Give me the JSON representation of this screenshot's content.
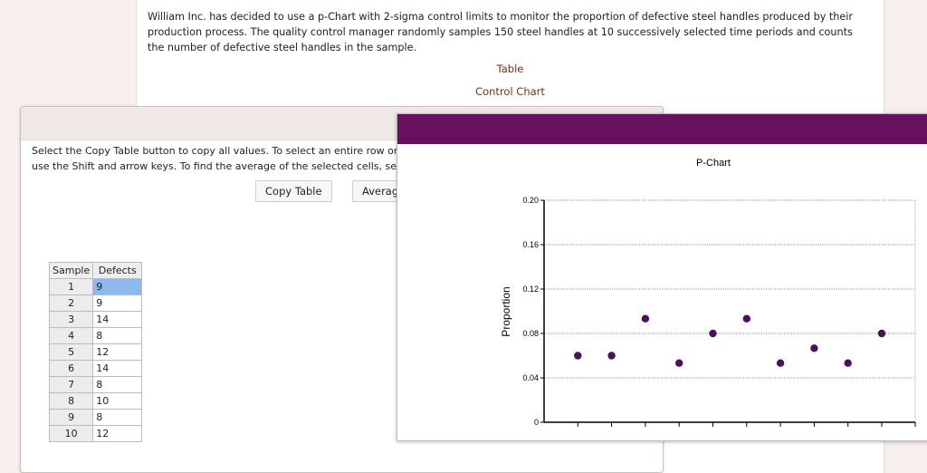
{
  "intro": "William Inc. has decided to use a p-Chart with 2-sigma control limits to monitor the proportion of defective steel handles produced by their production process. The quality control manager randomly samples 150 steel handles at 10 successively selected time periods and counts the number of defective steel handles in the sample.",
  "links": {
    "table": "Table",
    "control_chart": "Control Chart"
  },
  "dialog": {
    "instructions_line1": "Select the Copy Table button to copy all values. To select an entire row or co",
    "instructions_line2": "use the Shift and arrow keys. To find the average of the selected cells, select",
    "copy_button": "Copy Table",
    "average_button": "Average"
  },
  "table": {
    "headers": [
      "Sample",
      "Defects"
    ],
    "rows": [
      [
        "1",
        "9"
      ],
      [
        "2",
        "9"
      ],
      [
        "3",
        "14"
      ],
      [
        "4",
        "8"
      ],
      [
        "5",
        "12"
      ],
      [
        "6",
        "14"
      ],
      [
        "7",
        "8"
      ],
      [
        "8",
        "10"
      ],
      [
        "9",
        "8"
      ],
      [
        "10",
        "12"
      ]
    ]
  },
  "chart_data": {
    "type": "scatter",
    "title": "P-Chart",
    "xlabel": "",
    "ylabel": "Proportion",
    "x": [
      1,
      2,
      3,
      4,
      5,
      6,
      7,
      8,
      9,
      10
    ],
    "values": [
      0.06,
      0.06,
      0.0933,
      0.0533,
      0.08,
      0.0933,
      0.0533,
      0.0667,
      0.0533,
      0.08
    ],
    "ylim": [
      0,
      0.2
    ],
    "yticks": [
      "0",
      "0.04",
      "0.08",
      "0.12",
      "0.16",
      "0.20"
    ],
    "grid": true,
    "point_color": "#4b0f5c"
  }
}
